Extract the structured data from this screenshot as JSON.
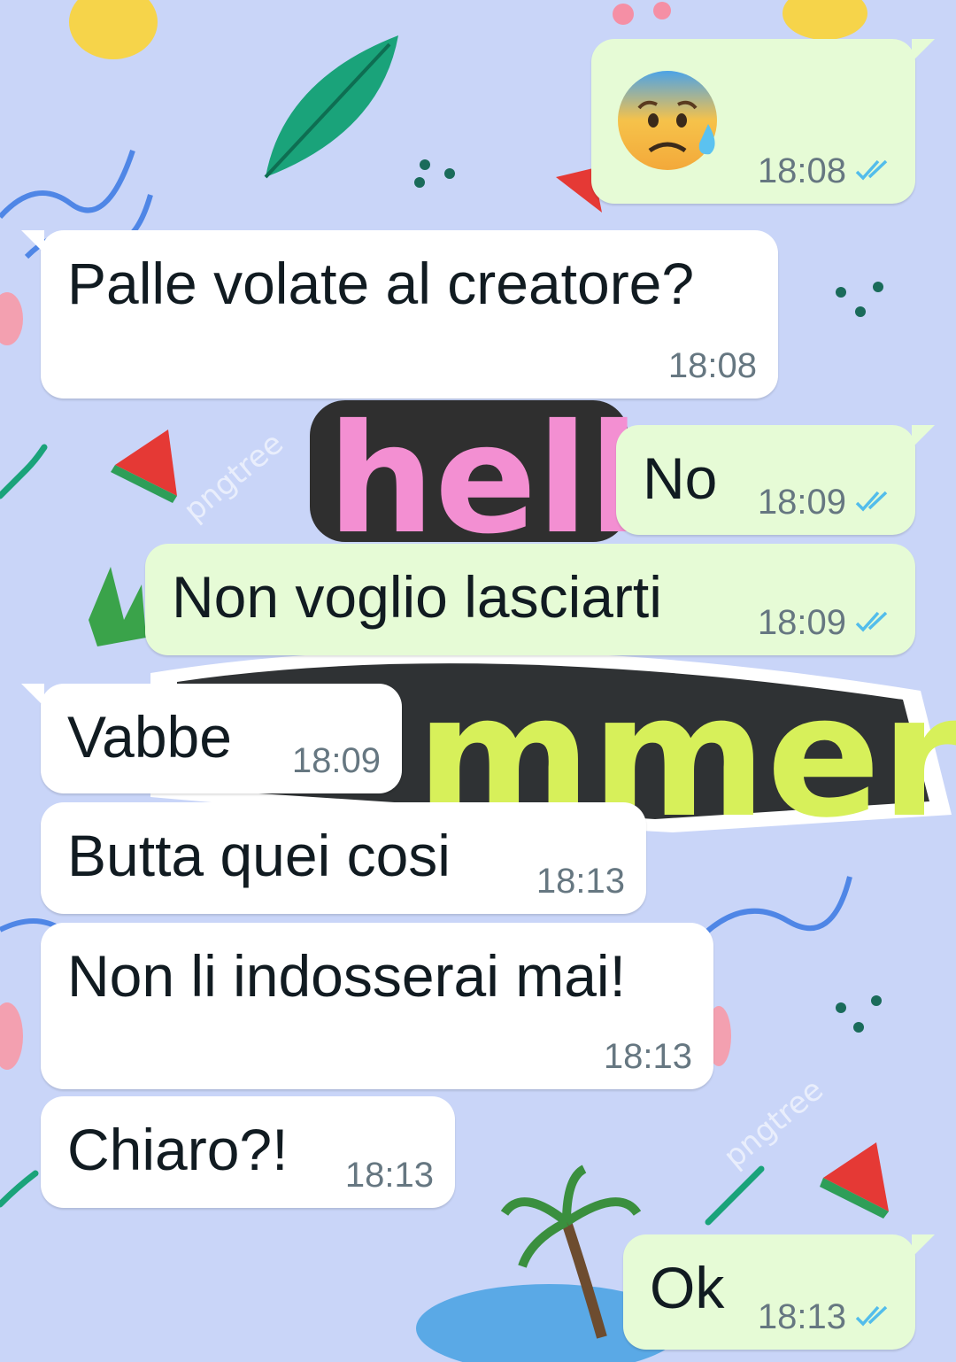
{
  "chat": {
    "accent_read": "#53bdeb",
    "messages": [
      {
        "id": 1,
        "direction": "outgoing",
        "type": "emoji",
        "emoji": "anxious-face-with-sweat",
        "time": "18:08",
        "status": "read"
      },
      {
        "id": 2,
        "direction": "incoming",
        "text": "Palle volate al creatore?",
        "time": "18:08"
      },
      {
        "id": 3,
        "direction": "outgoing",
        "text": "No",
        "time": "18:09",
        "status": "read"
      },
      {
        "id": 4,
        "direction": "outgoing",
        "text": "Non voglio lasciarti",
        "time": "18:09",
        "status": "read"
      },
      {
        "id": 5,
        "direction": "incoming",
        "text": "Vabbe",
        "time": "18:09"
      },
      {
        "id": 6,
        "direction": "incoming",
        "text": "Butta quei cosi",
        "time": "18:13"
      },
      {
        "id": 7,
        "direction": "incoming",
        "text": "Non li indosserai mai!",
        "time": "18:13"
      },
      {
        "id": 8,
        "direction": "incoming",
        "text": "Chiaro?!",
        "time": "18:13"
      },
      {
        "id": 9,
        "direction": "outgoing",
        "text": "Ok",
        "time": "18:13",
        "status": "read"
      }
    ]
  },
  "wallpaper": {
    "theme": "summer",
    "words": [
      "hello",
      "summer"
    ],
    "watermark": "pngtree"
  }
}
